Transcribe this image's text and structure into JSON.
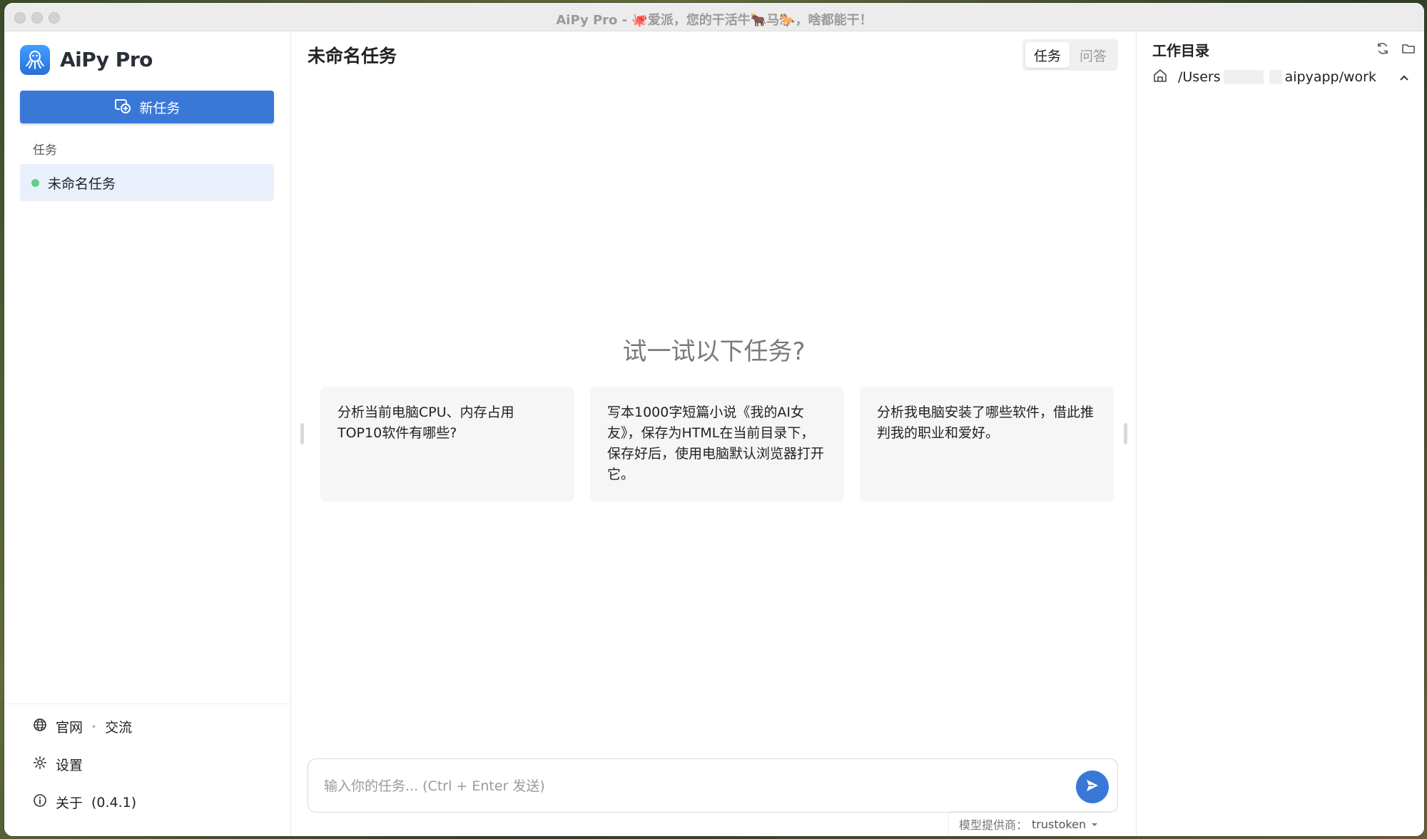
{
  "window": {
    "title": "AiPy Pro - 🐙爱派，您的干活牛🐂马🐎，啥都能干！"
  },
  "sidebar": {
    "app_name": "AiPy Pro",
    "logo_icon": "octopus-logo-icon",
    "new_task_label": "新任务",
    "section_label": "任务",
    "tasks": [
      {
        "label": "未命名任务",
        "status_color": "#5fcf8c"
      }
    ],
    "footer": {
      "website_label": "官网",
      "separator": "•",
      "community_label": "交流",
      "settings_label": "设置",
      "about_label": "关于",
      "version": "(0.4.1)"
    }
  },
  "main": {
    "title": "未命名任务",
    "mode_tabs": [
      {
        "label": "任务",
        "active": true
      },
      {
        "label": "问答",
        "active": false
      }
    ],
    "try_heading": "试一试以下任务?",
    "suggestions": [
      "分析当前电脑CPU、内存占用TOP10软件有哪些?",
      "写本1000字短篇小说《我的AI女友》，保存为HTML在当前目录下，保存好后，使用电脑默认浏览器打开它。",
      "分析我电脑安装了哪些软件，借此推判我的职业和爱好。"
    ],
    "input_placeholder": "输入你的任务... (Ctrl + Enter 发送)",
    "input_value": "",
    "provider_label": "模型提供商：",
    "provider_value": "trustoken"
  },
  "right_panel": {
    "title": "工作目录",
    "path_prefix": "/Users",
    "path_suffix": "aipyapp/work"
  },
  "colors": {
    "accent": "#3a78d8",
    "active_task_bg": "#e9f0fb",
    "card_bg": "#f6f6f6"
  }
}
